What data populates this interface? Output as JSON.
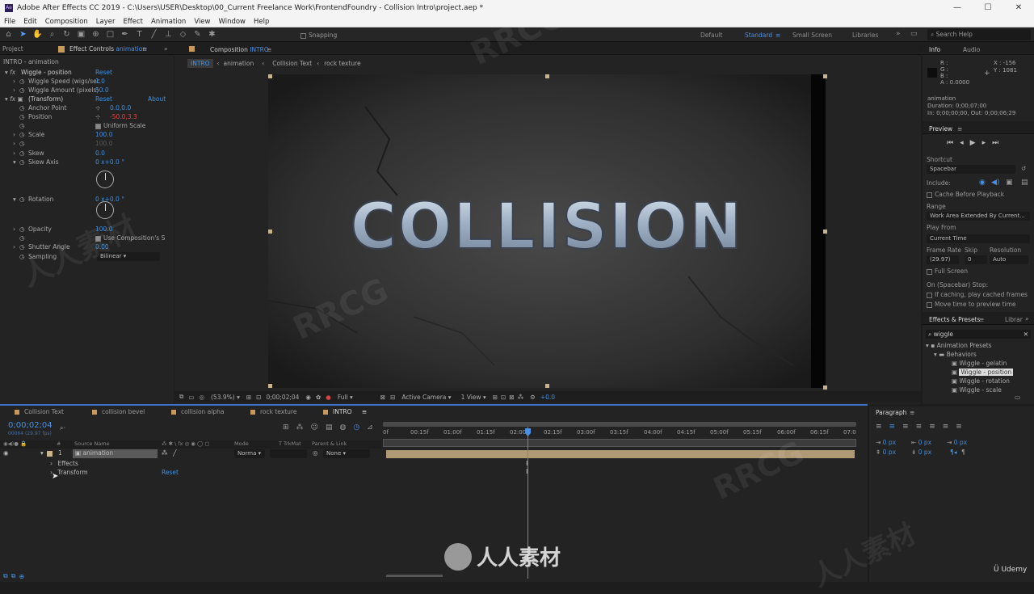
{
  "window": {
    "title": "Adobe After Effects CC 2019 - C:\\Users\\USER\\Desktop\\00_Current Freelance Work\\FrontendFoundry - Collision Intro\\project.aep *",
    "app_badge": "Ae"
  },
  "menu": [
    "File",
    "Edit",
    "Composition",
    "Layer",
    "Effect",
    "Animation",
    "View",
    "Window",
    "Help"
  ],
  "toolbar": {
    "snapping": "Snapping",
    "workspaces": [
      "Default",
      "Standard",
      "Small Screen",
      "Libraries"
    ],
    "active_workspace": "Standard",
    "search_placeholder": "Search Help"
  },
  "project_tab": "Project",
  "effect_controls": {
    "tab_label": "Effect Controls",
    "tab_layer": "animation",
    "header": "INTRO - animation",
    "rows": [
      {
        "label": "Wiggle - position",
        "value": "Reset",
        "fx": true
      },
      {
        "label": "Wiggle Speed (wigs/sec",
        "value": "1.0"
      },
      {
        "label": "Wiggle Amount (pixels)",
        "value": "50.0"
      },
      {
        "label": "(Transform)",
        "value": "Reset",
        "extra": "About",
        "fx": true
      },
      {
        "label": "Anchor Point",
        "value": "0.0,0.0"
      },
      {
        "label": "Position",
        "value": "-50.0,3.3"
      },
      {
        "label": "",
        "value": "Uniform Scale"
      },
      {
        "label": "Scale",
        "value": "100.0"
      },
      {
        "label": "",
        "value": "100.0"
      },
      {
        "label": "Skew",
        "value": "0.0"
      },
      {
        "label": "Skew Axis",
        "value": "0 x+0.0 °"
      },
      {
        "label": "Rotation",
        "value": "0 x+0.0 °"
      },
      {
        "label": "Opacity",
        "value": "100.0"
      },
      {
        "label": "",
        "value": "Use Composition's S"
      },
      {
        "label": "Shutter Angle",
        "value": "0.00"
      },
      {
        "label": "Sampling",
        "value": "Bilinear"
      }
    ]
  },
  "composition": {
    "tab_label": "Composition",
    "tab_name": "INTRO",
    "breadcrumbs": [
      "INTRO",
      "animation",
      "Collision Text",
      "rock texture"
    ],
    "title_text": "COLLISION",
    "footer": {
      "zoom": "(53.9%)",
      "timecode": "0;00;02;04",
      "resolution": "Full",
      "camera": "Active Camera",
      "views": "1 View",
      "exposure": "+0.0"
    }
  },
  "info": {
    "tab": "Info",
    "tab2": "Audio",
    "r": "R :",
    "g": "G :",
    "b": "B :",
    "a": "A : 0.0000",
    "x": "X : -156",
    "y": "Y : 1081",
    "layer": "animation",
    "duration": "Duration: 0;00;07;00",
    "inout": "In: 0;00;00;00, Out: 0;00;06;29"
  },
  "preview": {
    "tab": "Preview",
    "shortcut_label": "Shortcut",
    "shortcut": "Spacebar",
    "include": "Include:",
    "cache": "Cache Before Playback",
    "range_label": "Range",
    "range": "Work Area Extended By Current...",
    "playfrom_label": "Play From",
    "playfrom": "Current Time",
    "framerate_label": "Frame Rate",
    "skip_label": "Skip",
    "resolution_label": "Resolution",
    "framerate": "(29.97)",
    "skip": "0",
    "resolution": "Auto",
    "fullscreen": "Full Screen",
    "stop_label": "On (Spacebar) Stop:",
    "stop1": "If caching, play cached frames",
    "stop2": "Move time to preview time"
  },
  "effects_presets": {
    "tab": "Effects & Presets",
    "tab2": "Librar",
    "search": "wiggle",
    "tree": [
      "Animation Presets",
      "Behaviors",
      "Wiggle - gelatin",
      "Wiggle - position",
      "Wiggle - rotation",
      "Wiggle - scale"
    ],
    "selected": "Wiggle - position"
  },
  "timeline": {
    "tabs": [
      "Collision Text",
      "collision bevel",
      "collision alpha",
      "rock texture",
      "INTRO"
    ],
    "active_tab": "INTRO",
    "timecode": "0;00;02;04",
    "fps": "00064 (29.97 fps)",
    "columns": {
      "source": "Source Name",
      "mode": "Mode",
      "trkmat": "T TrkMat",
      "parent": "Parent & Link",
      "num": "#"
    },
    "layer": {
      "num": "1",
      "name": "animation",
      "mode": "Norma",
      "parent": "None"
    },
    "children": [
      "Effects",
      "Transform"
    ],
    "transform_reset": "Reset",
    "ticks": [
      "0f",
      "00:15f",
      "01:00f",
      "01:15f",
      "02:00f",
      "02:15f",
      "03:00f",
      "03:15f",
      "04:00f",
      "04:15f",
      "05:00f",
      "05:15f",
      "06:00f",
      "06:15f",
      "07:0"
    ]
  },
  "paragraph": {
    "tab": "Paragraph",
    "v1": "0 px",
    "v2": "0 px",
    "v3": "0 px",
    "v4": "0 px",
    "v5": "0 px"
  },
  "watermark": {
    "brand": "RRCG",
    "cn": "人人素材",
    "center": "人人素材",
    "udemy": "Udemy"
  }
}
